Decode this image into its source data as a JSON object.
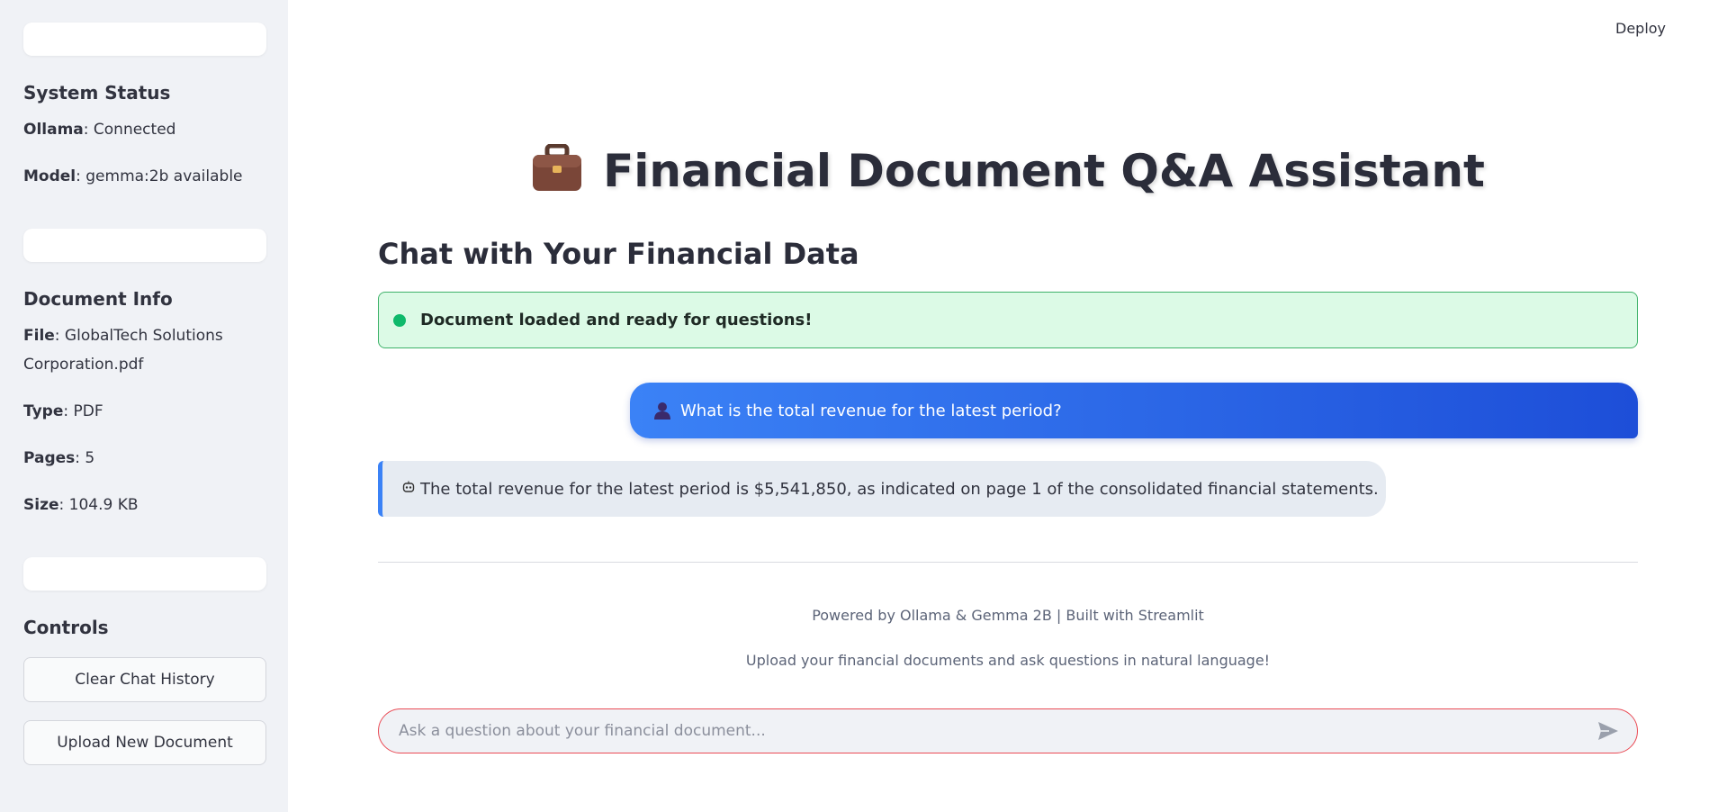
{
  "header": {
    "deploy_label": "Deploy"
  },
  "sidebar": {
    "system_status": {
      "heading": "System Status",
      "ollama_label": "Ollama",
      "ollama_value": ": Connected",
      "model_label": "Model",
      "model_value": ": gemma:2b available"
    },
    "document_info": {
      "heading": "Document Info",
      "file_label": "File",
      "file_value": ": GlobalTech Solutions Corporation.pdf",
      "type_label": "Type",
      "type_value": ": PDF",
      "pages_label": "Pages",
      "pages_value": ": 5",
      "size_label": "Size",
      "size_value": ": 104.9 KB"
    },
    "controls": {
      "heading": "Controls",
      "clear_label": "Clear Chat History",
      "upload_label": "Upload New Document"
    }
  },
  "main": {
    "title": "Financial Document Q&A Assistant",
    "subtitle": "Chat with Your Financial Data",
    "alert": "Document loaded and ready for questions!",
    "messages": [
      {
        "role": "user",
        "text": "What is the total revenue for the latest period?"
      },
      {
        "role": "assistant",
        "text": "The total revenue for the latest period is $5,541,850, as indicated on page 1 of the consolidated financial statements."
      }
    ],
    "footer": {
      "line1": "Powered by Ollama & Gemma 2B | Built with Streamlit",
      "line2": "Upload your financial documents and ask questions in natural language!"
    },
    "chat_input": {
      "placeholder": "Ask a question about your financial document..."
    }
  },
  "colors": {
    "sidebar_bg": "#f0f2f6",
    "success_bg": "#dcfae6",
    "success_border": "#3fb26a",
    "user_bubble_start": "#3b82f6",
    "user_bubble_end": "#1d4ed8",
    "input_border": "#ea4b55"
  },
  "icons": {
    "title": "briefcase-icon",
    "alert": "status-dot-icon",
    "user": "user-avatar-icon",
    "assistant": "robot-icon",
    "send": "send-icon"
  }
}
